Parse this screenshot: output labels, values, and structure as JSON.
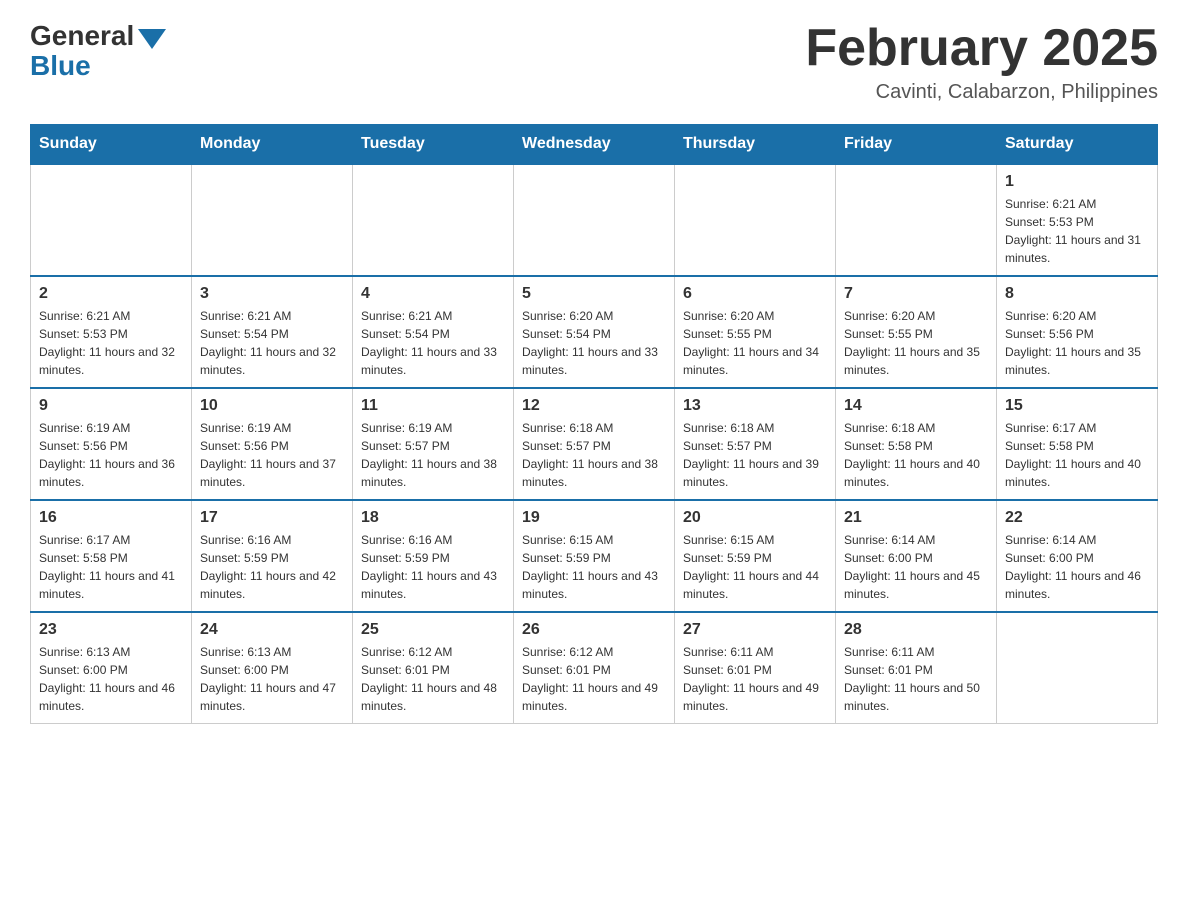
{
  "logo": {
    "general": "General",
    "blue": "Blue"
  },
  "header": {
    "title": "February 2025",
    "location": "Cavinti, Calabarzon, Philippines"
  },
  "days_of_week": [
    "Sunday",
    "Monday",
    "Tuesday",
    "Wednesday",
    "Thursday",
    "Friday",
    "Saturday"
  ],
  "weeks": [
    [
      {
        "day": "",
        "info": ""
      },
      {
        "day": "",
        "info": ""
      },
      {
        "day": "",
        "info": ""
      },
      {
        "day": "",
        "info": ""
      },
      {
        "day": "",
        "info": ""
      },
      {
        "day": "",
        "info": ""
      },
      {
        "day": "1",
        "info": "Sunrise: 6:21 AM\nSunset: 5:53 PM\nDaylight: 11 hours and 31 minutes."
      }
    ],
    [
      {
        "day": "2",
        "info": "Sunrise: 6:21 AM\nSunset: 5:53 PM\nDaylight: 11 hours and 32 minutes."
      },
      {
        "day": "3",
        "info": "Sunrise: 6:21 AM\nSunset: 5:54 PM\nDaylight: 11 hours and 32 minutes."
      },
      {
        "day": "4",
        "info": "Sunrise: 6:21 AM\nSunset: 5:54 PM\nDaylight: 11 hours and 33 minutes."
      },
      {
        "day": "5",
        "info": "Sunrise: 6:20 AM\nSunset: 5:54 PM\nDaylight: 11 hours and 33 minutes."
      },
      {
        "day": "6",
        "info": "Sunrise: 6:20 AM\nSunset: 5:55 PM\nDaylight: 11 hours and 34 minutes."
      },
      {
        "day": "7",
        "info": "Sunrise: 6:20 AM\nSunset: 5:55 PM\nDaylight: 11 hours and 35 minutes."
      },
      {
        "day": "8",
        "info": "Sunrise: 6:20 AM\nSunset: 5:56 PM\nDaylight: 11 hours and 35 minutes."
      }
    ],
    [
      {
        "day": "9",
        "info": "Sunrise: 6:19 AM\nSunset: 5:56 PM\nDaylight: 11 hours and 36 minutes."
      },
      {
        "day": "10",
        "info": "Sunrise: 6:19 AM\nSunset: 5:56 PM\nDaylight: 11 hours and 37 minutes."
      },
      {
        "day": "11",
        "info": "Sunrise: 6:19 AM\nSunset: 5:57 PM\nDaylight: 11 hours and 38 minutes."
      },
      {
        "day": "12",
        "info": "Sunrise: 6:18 AM\nSunset: 5:57 PM\nDaylight: 11 hours and 38 minutes."
      },
      {
        "day": "13",
        "info": "Sunrise: 6:18 AM\nSunset: 5:57 PM\nDaylight: 11 hours and 39 minutes."
      },
      {
        "day": "14",
        "info": "Sunrise: 6:18 AM\nSunset: 5:58 PM\nDaylight: 11 hours and 40 minutes."
      },
      {
        "day": "15",
        "info": "Sunrise: 6:17 AM\nSunset: 5:58 PM\nDaylight: 11 hours and 40 minutes."
      }
    ],
    [
      {
        "day": "16",
        "info": "Sunrise: 6:17 AM\nSunset: 5:58 PM\nDaylight: 11 hours and 41 minutes."
      },
      {
        "day": "17",
        "info": "Sunrise: 6:16 AM\nSunset: 5:59 PM\nDaylight: 11 hours and 42 minutes."
      },
      {
        "day": "18",
        "info": "Sunrise: 6:16 AM\nSunset: 5:59 PM\nDaylight: 11 hours and 43 minutes."
      },
      {
        "day": "19",
        "info": "Sunrise: 6:15 AM\nSunset: 5:59 PM\nDaylight: 11 hours and 43 minutes."
      },
      {
        "day": "20",
        "info": "Sunrise: 6:15 AM\nSunset: 5:59 PM\nDaylight: 11 hours and 44 minutes."
      },
      {
        "day": "21",
        "info": "Sunrise: 6:14 AM\nSunset: 6:00 PM\nDaylight: 11 hours and 45 minutes."
      },
      {
        "day": "22",
        "info": "Sunrise: 6:14 AM\nSunset: 6:00 PM\nDaylight: 11 hours and 46 minutes."
      }
    ],
    [
      {
        "day": "23",
        "info": "Sunrise: 6:13 AM\nSunset: 6:00 PM\nDaylight: 11 hours and 46 minutes."
      },
      {
        "day": "24",
        "info": "Sunrise: 6:13 AM\nSunset: 6:00 PM\nDaylight: 11 hours and 47 minutes."
      },
      {
        "day": "25",
        "info": "Sunrise: 6:12 AM\nSunset: 6:01 PM\nDaylight: 11 hours and 48 minutes."
      },
      {
        "day": "26",
        "info": "Sunrise: 6:12 AM\nSunset: 6:01 PM\nDaylight: 11 hours and 49 minutes."
      },
      {
        "day": "27",
        "info": "Sunrise: 6:11 AM\nSunset: 6:01 PM\nDaylight: 11 hours and 49 minutes."
      },
      {
        "day": "28",
        "info": "Sunrise: 6:11 AM\nSunset: 6:01 PM\nDaylight: 11 hours and 50 minutes."
      },
      {
        "day": "",
        "info": ""
      }
    ]
  ]
}
